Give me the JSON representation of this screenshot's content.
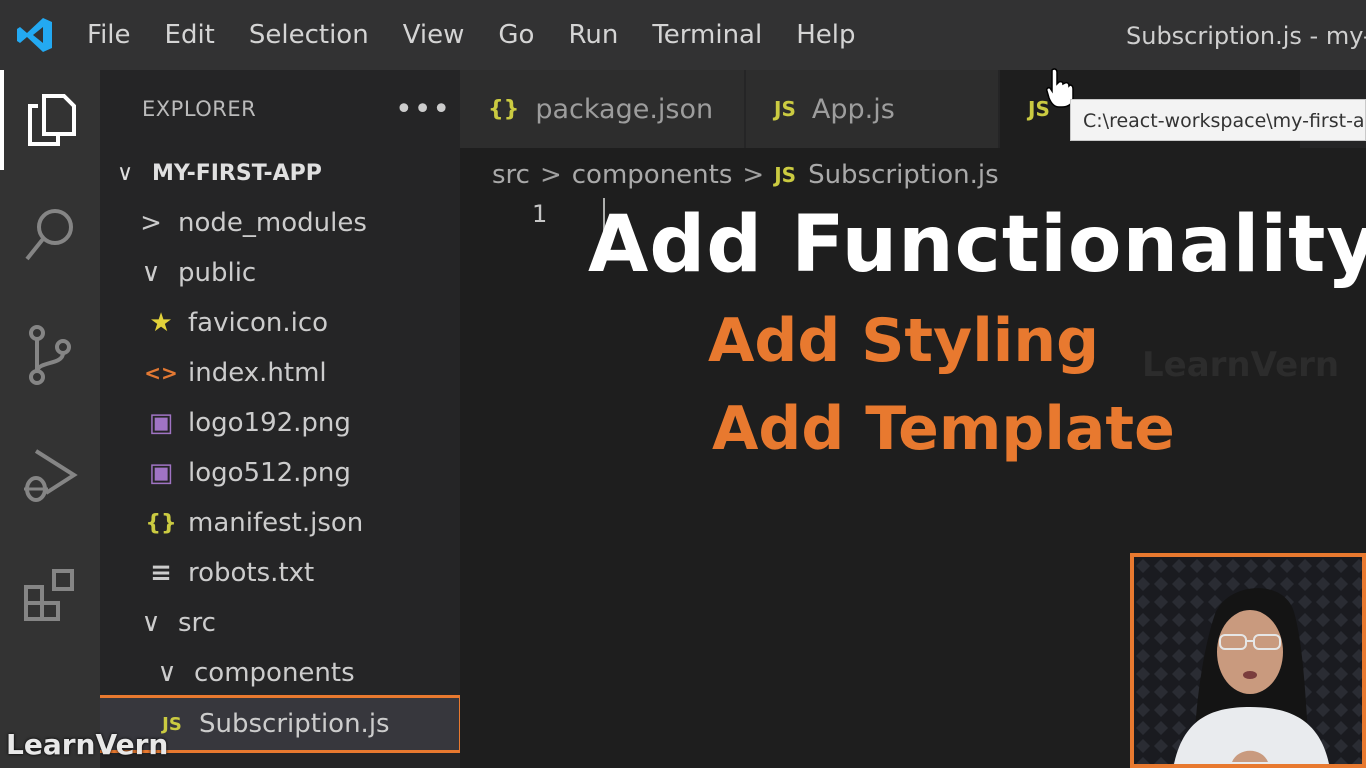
{
  "menu": [
    "File",
    "Edit",
    "Selection",
    "View",
    "Go",
    "Run",
    "Terminal",
    "Help"
  ],
  "window_title": "Subscription.js - my-f",
  "sidebar": {
    "header": "EXPLORER",
    "more": "•••",
    "root": "MY-FIRST-APP",
    "items": [
      {
        "label": "node_modules",
        "icon": "chevron-right-icon",
        "glyph": ">"
      },
      {
        "label": "public",
        "icon": "chevron-down-icon",
        "glyph": "∨"
      },
      {
        "label": "favicon.ico",
        "icon": "star-icon",
        "glyph": "★"
      },
      {
        "label": "index.html",
        "icon": "html-icon",
        "glyph": "<>"
      },
      {
        "label": "logo192.png",
        "icon": "image-icon",
        "glyph": "▣"
      },
      {
        "label": "logo512.png",
        "icon": "image-icon",
        "glyph": "▣"
      },
      {
        "label": "manifest.json",
        "icon": "json-icon",
        "glyph": "{}"
      },
      {
        "label": "robots.txt",
        "icon": "text-file-icon",
        "glyph": "≡"
      },
      {
        "label": "src",
        "icon": "chevron-down-icon",
        "glyph": "∨"
      },
      {
        "label": "components",
        "icon": "chevron-down-icon",
        "glyph": "∨"
      },
      {
        "label": "Subscription.js",
        "icon": "js-icon",
        "glyph": "JS"
      }
    ]
  },
  "tabs": [
    {
      "label": "package.json",
      "glyph": "{}"
    },
    {
      "label": "App.js",
      "glyph": "JS"
    },
    {
      "label": "",
      "glyph": "JS"
    }
  ],
  "tooltip": "C:\\react-workspace\\my-first-ap",
  "breadcrumb": [
    "src",
    "components",
    "Subscription.js"
  ],
  "breadcrumb_sep": ">",
  "breadcrumb_glyph": "JS",
  "editor": {
    "line_number": "1"
  },
  "overlay": {
    "title": "Add Functionality",
    "items": [
      "Add Styling",
      "Add Template"
    ]
  },
  "watermarks": {
    "faint": "LearnVern",
    "main": "LearnVern"
  },
  "colors": {
    "accent_orange": "#e8792f",
    "js_yellow": "#cbcb41",
    "json_yellow": "#cbcb41",
    "html_orange": "#e37933",
    "image_purple": "#a074c4",
    "vscode_blue": "#23a9f2"
  }
}
